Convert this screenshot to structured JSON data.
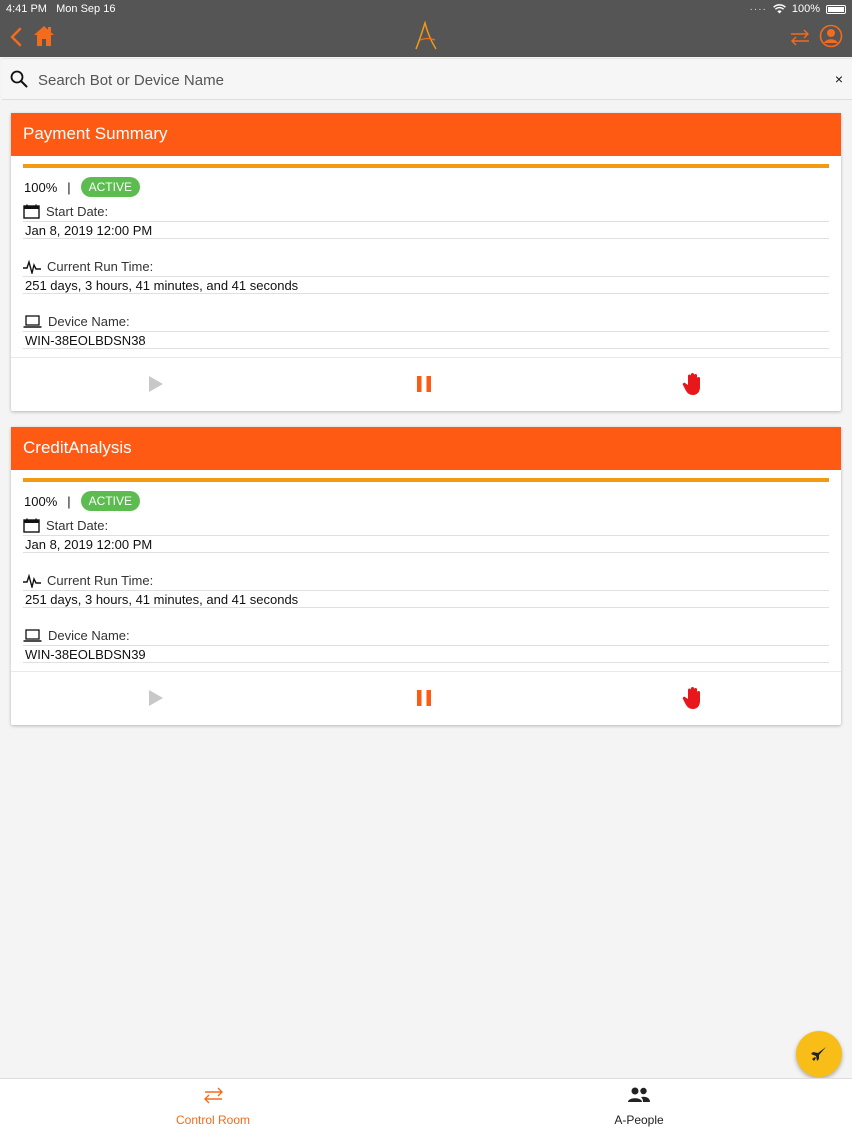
{
  "status_bar": {
    "time": "4:41 PM",
    "date": "Mon Sep 16",
    "battery": "100%"
  },
  "search": {
    "placeholder": "Search Bot or Device Name",
    "clear": "×"
  },
  "colors": {
    "accent": "#ff5a14",
    "progress": "#f39a12",
    "active_badge": "#5cbc50",
    "fab": "#f8bd17",
    "stop": "#e8171b",
    "top_bar": "#555555"
  },
  "cards": [
    {
      "title": "Payment Summary",
      "percent": "100%",
      "separator": "|",
      "status": "ACTIVE",
      "progress": 1.0,
      "start_date_label": "Start Date:",
      "start_date": "Jan 8, 2019 12:00 PM",
      "run_time_label": "Current Run Time:",
      "run_time": "251 days, 3 hours, 41 minutes, and 41 seconds",
      "device_label": "Device Name:",
      "device": "WIN-38EOLBDSN38"
    },
    {
      "title": "CreditAnalysis",
      "percent": "100%",
      "separator": "|",
      "status": "ACTIVE",
      "progress": 1.0,
      "start_date_label": "Start Date:",
      "start_date": "Jan 8, 2019 12:00 PM",
      "run_time_label": "Current Run Time:",
      "run_time": "251 days, 3 hours, 41 minutes, and 41 seconds",
      "device_label": "Device Name:",
      "device": "WIN-38EOLBDSN39"
    }
  ],
  "tabs": [
    {
      "label": "Control Room",
      "icon": "swap-arrows-icon",
      "active": true
    },
    {
      "label": "A-People",
      "icon": "people-icon",
      "active": false
    }
  ]
}
